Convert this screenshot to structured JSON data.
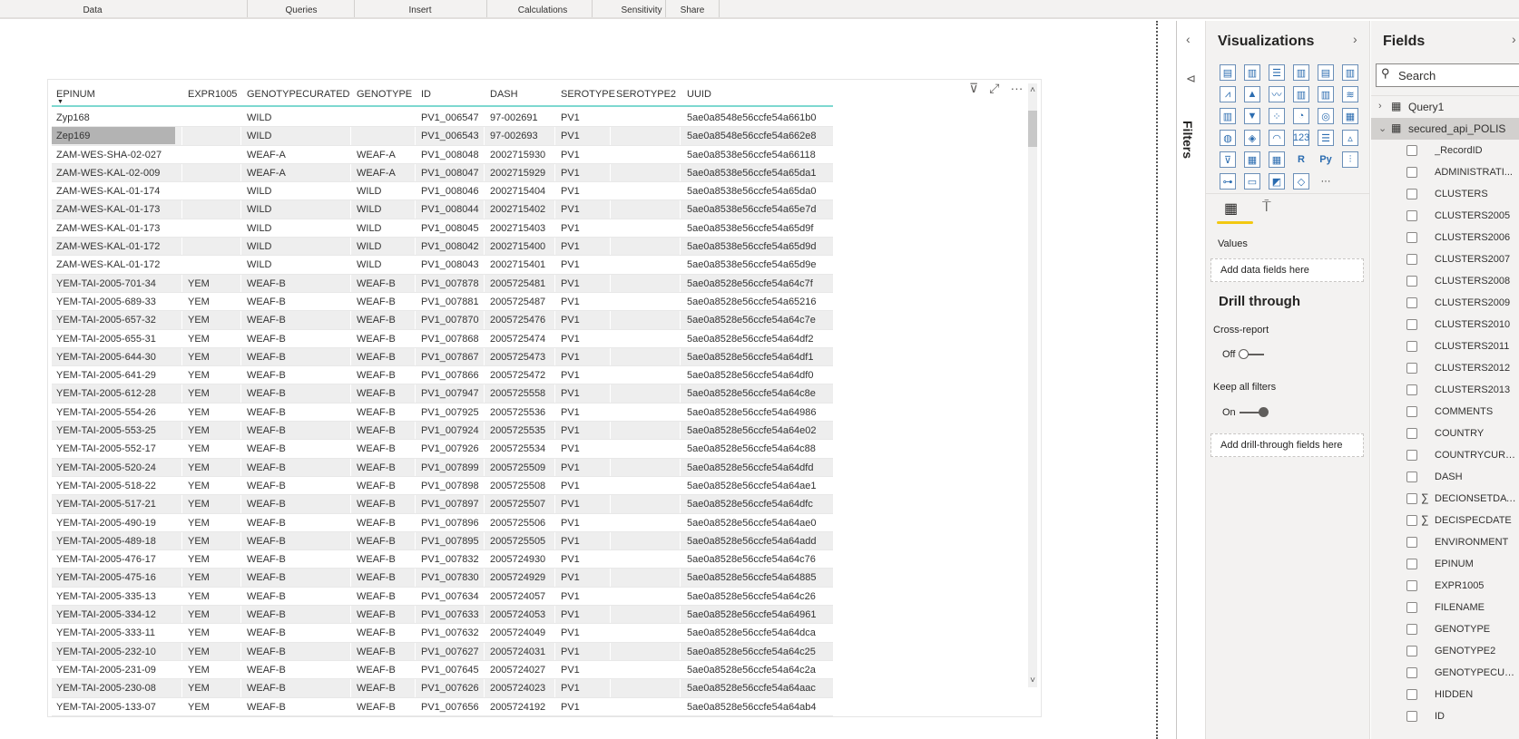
{
  "ribbon": {
    "groups": [
      "Data",
      "Queries",
      "Insert",
      "Calculations",
      "Sensitivity",
      "Share"
    ]
  },
  "visual_header": {
    "icons": [
      "filter-icon",
      "focus-mode-icon",
      "more-options-icon"
    ],
    "more": "···"
  },
  "table": {
    "columns": [
      "EPINUM",
      "EXPR1005",
      "GENOTYPECURATED",
      "GENOTYPE",
      "ID",
      "DASH",
      "SEROTYPE",
      "SEROTYPE2",
      "UUID"
    ],
    "sort_indicator": "▼",
    "selected_cell": {
      "row": 1,
      "column": "EPINUM"
    },
    "rows": [
      [
        "Zyp168",
        "",
        "WILD",
        "",
        "PV1_006547",
        "97-002691",
        "PV1",
        "",
        "5ae0a8548e56ccfe54a661b0"
      ],
      [
        "Zep169",
        "",
        "WILD",
        "",
        "PV1_006543",
        "97-002693",
        "PV1",
        "",
        "5ae0a8548e56ccfe54a662e8"
      ],
      [
        "ZAM-WES-SHA-02-027",
        "",
        "WEAF-A",
        "WEAF-A",
        "PV1_008048",
        "2002715930",
        "PV1",
        "",
        "5ae0a8538e56ccfe54a66118"
      ],
      [
        "ZAM-WES-KAL-02-009",
        "",
        "WEAF-A",
        "WEAF-A",
        "PV1_008047",
        "2002715929",
        "PV1",
        "",
        "5ae0a8538e56ccfe54a65da1"
      ],
      [
        "ZAM-WES-KAL-01-174",
        "",
        "WILD",
        "WILD",
        "PV1_008046",
        "2002715404",
        "PV1",
        "",
        "5ae0a8538e56ccfe54a65da0"
      ],
      [
        "ZAM-WES-KAL-01-173",
        "",
        "WILD",
        "WILD",
        "PV1_008044",
        "2002715402",
        "PV1",
        "",
        "5ae0a8538e56ccfe54a65e7d"
      ],
      [
        "ZAM-WES-KAL-01-173",
        "",
        "WILD",
        "WILD",
        "PV1_008045",
        "2002715403",
        "PV1",
        "",
        "5ae0a8538e56ccfe54a65d9f"
      ],
      [
        "ZAM-WES-KAL-01-172",
        "",
        "WILD",
        "WILD",
        "PV1_008042",
        "2002715400",
        "PV1",
        "",
        "5ae0a8538e56ccfe54a65d9d"
      ],
      [
        "ZAM-WES-KAL-01-172",
        "",
        "WILD",
        "WILD",
        "PV1_008043",
        "2002715401",
        "PV1",
        "",
        "5ae0a8538e56ccfe54a65d9e"
      ],
      [
        "YEM-TAI-2005-701-34",
        "YEM",
        "WEAF-B",
        "WEAF-B",
        "PV1_007878",
        "2005725481",
        "PV1",
        "",
        "5ae0a8528e56ccfe54a64c7f"
      ],
      [
        "YEM-TAI-2005-689-33",
        "YEM",
        "WEAF-B",
        "WEAF-B",
        "PV1_007881",
        "2005725487",
        "PV1",
        "",
        "5ae0a8528e56ccfe54a65216"
      ],
      [
        "YEM-TAI-2005-657-32",
        "YEM",
        "WEAF-B",
        "WEAF-B",
        "PV1_007870",
        "2005725476",
        "PV1",
        "",
        "5ae0a8528e56ccfe54a64c7e"
      ],
      [
        "YEM-TAI-2005-655-31",
        "YEM",
        "WEAF-B",
        "WEAF-B",
        "PV1_007868",
        "2005725474",
        "PV1",
        "",
        "5ae0a8528e56ccfe54a64df2"
      ],
      [
        "YEM-TAI-2005-644-30",
        "YEM",
        "WEAF-B",
        "WEAF-B",
        "PV1_007867",
        "2005725473",
        "PV1",
        "",
        "5ae0a8528e56ccfe54a64df1"
      ],
      [
        "YEM-TAI-2005-641-29",
        "YEM",
        "WEAF-B",
        "WEAF-B",
        "PV1_007866",
        "2005725472",
        "PV1",
        "",
        "5ae0a8528e56ccfe54a64df0"
      ],
      [
        "YEM-TAI-2005-612-28",
        "YEM",
        "WEAF-B",
        "WEAF-B",
        "PV1_007947",
        "2005725558",
        "PV1",
        "",
        "5ae0a8528e56ccfe54a64c8e"
      ],
      [
        "YEM-TAI-2005-554-26",
        "YEM",
        "WEAF-B",
        "WEAF-B",
        "PV1_007925",
        "2005725536",
        "PV1",
        "",
        "5ae0a8528e56ccfe54a64986"
      ],
      [
        "YEM-TAI-2005-553-25",
        "YEM",
        "WEAF-B",
        "WEAF-B",
        "PV1_007924",
        "2005725535",
        "PV1",
        "",
        "5ae0a8528e56ccfe54a64e02"
      ],
      [
        "YEM-TAI-2005-552-17",
        "YEM",
        "WEAF-B",
        "WEAF-B",
        "PV1_007926",
        "2005725534",
        "PV1",
        "",
        "5ae0a8528e56ccfe54a64c88"
      ],
      [
        "YEM-TAI-2005-520-24",
        "YEM",
        "WEAF-B",
        "WEAF-B",
        "PV1_007899",
        "2005725509",
        "PV1",
        "",
        "5ae0a8528e56ccfe54a64dfd"
      ],
      [
        "YEM-TAI-2005-518-22",
        "YEM",
        "WEAF-B",
        "WEAF-B",
        "PV1_007898",
        "2005725508",
        "PV1",
        "",
        "5ae0a8528e56ccfe54a64ae1"
      ],
      [
        "YEM-TAI-2005-517-21",
        "YEM",
        "WEAF-B",
        "WEAF-B",
        "PV1_007897",
        "2005725507",
        "PV1",
        "",
        "5ae0a8528e56ccfe54a64dfc"
      ],
      [
        "YEM-TAI-2005-490-19",
        "YEM",
        "WEAF-B",
        "WEAF-B",
        "PV1_007896",
        "2005725506",
        "PV1",
        "",
        "5ae0a8528e56ccfe54a64ae0"
      ],
      [
        "YEM-TAI-2005-489-18",
        "YEM",
        "WEAF-B",
        "WEAF-B",
        "PV1_007895",
        "2005725505",
        "PV1",
        "",
        "5ae0a8528e56ccfe54a64add"
      ],
      [
        "YEM-TAI-2005-476-17",
        "YEM",
        "WEAF-B",
        "WEAF-B",
        "PV1_007832",
        "2005724930",
        "PV1",
        "",
        "5ae0a8528e56ccfe54a64c76"
      ],
      [
        "YEM-TAI-2005-475-16",
        "YEM",
        "WEAF-B",
        "WEAF-B",
        "PV1_007830",
        "2005724929",
        "PV1",
        "",
        "5ae0a8528e56ccfe54a64885"
      ],
      [
        "YEM-TAI-2005-335-13",
        "YEM",
        "WEAF-B",
        "WEAF-B",
        "PV1_007634",
        "2005724057",
        "PV1",
        "",
        "5ae0a8528e56ccfe54a64c26"
      ],
      [
        "YEM-TAI-2005-334-12",
        "YEM",
        "WEAF-B",
        "WEAF-B",
        "PV1_007633",
        "2005724053",
        "PV1",
        "",
        "5ae0a8528e56ccfe54a64961"
      ],
      [
        "YEM-TAI-2005-333-11",
        "YEM",
        "WEAF-B",
        "WEAF-B",
        "PV1_007632",
        "2005724049",
        "PV1",
        "",
        "5ae0a8528e56ccfe54a64dca"
      ],
      [
        "YEM-TAI-2005-232-10",
        "YEM",
        "WEAF-B",
        "WEAF-B",
        "PV1_007627",
        "2005724031",
        "PV1",
        "",
        "5ae0a8528e56ccfe54a64c25"
      ],
      [
        "YEM-TAI-2005-231-09",
        "YEM",
        "WEAF-B",
        "WEAF-B",
        "PV1_007645",
        "2005724027",
        "PV1",
        "",
        "5ae0a8528e56ccfe54a64c2a"
      ],
      [
        "YEM-TAI-2005-230-08",
        "YEM",
        "WEAF-B",
        "WEAF-B",
        "PV1_007626",
        "2005724023",
        "PV1",
        "",
        "5ae0a8528e56ccfe54a64aac"
      ],
      [
        "YEM-TAI-2005-133-07",
        "YEM",
        "WEAF-B",
        "WEAF-B",
        "PV1_007656",
        "2005724192",
        "PV1",
        "",
        "5ae0a8528e56ccfe54a64ab4"
      ]
    ]
  },
  "filters": {
    "label": "Filters",
    "collapse": "‹",
    "icon": "filter-icon"
  },
  "visualizations": {
    "title": "Visualizations",
    "expand": "›",
    "icons": [
      [
        "stacked-bar",
        "stacked-column",
        "clustered-bar",
        "clustered-column",
        "100-stacked-bar",
        "100-stacked-column"
      ],
      [
        "line",
        "area",
        "stacked-area",
        "line-stacked-column",
        "line-clustered-column",
        "ribbon"
      ],
      [
        "waterfall",
        "funnel",
        "scatter",
        "pie",
        "donut",
        "treemap"
      ],
      [
        "map",
        "filled-map",
        "gauge",
        "card",
        "multi-row-card",
        "kpi"
      ],
      [
        "slicer",
        "table",
        "matrix",
        "r-script",
        "python",
        "key-influencers"
      ],
      [
        "decomposition-tree",
        "qna",
        "arcgis",
        "power-apps",
        "more"
      ]
    ],
    "icon_glyphs": [
      [
        "▤",
        "▥",
        "☰",
        "▥",
        "▤",
        "▥"
      ],
      [
        "⩘",
        "▲",
        "〰",
        "▥",
        "▥",
        "≋"
      ],
      [
        "▥",
        "▼",
        "⁘",
        "◔",
        "◎",
        "▦"
      ],
      [
        "◍",
        "◈",
        "◠",
        "123",
        "☰",
        "▵"
      ],
      [
        "⊽",
        "▦",
        "▦",
        "R",
        "Py",
        "⫶"
      ],
      [
        "⊶",
        "▭",
        "◩",
        "◇",
        "···"
      ]
    ],
    "tabs": {
      "fields": "fields-tab-icon",
      "format": "format-paint-roller-icon"
    },
    "values_label": "Values",
    "values_placeholder": "Add data fields here",
    "drill_title": "Drill through",
    "cross_report_label": "Cross-report",
    "cross_report_state": "Off",
    "cross_report_on": false,
    "keep_filters_label": "Keep all filters",
    "keep_filters_state": "On",
    "keep_filters_on": true,
    "drill_placeholder": "Add drill-through fields here"
  },
  "fields": {
    "title": "Fields",
    "close": "›",
    "search_placeholder": "Search",
    "tables": [
      {
        "name": "Query1",
        "expanded": false
      },
      {
        "name": "secured_api_POLIS",
        "expanded": true
      }
    ],
    "items": [
      {
        "name": "_RecordID",
        "sigma": false
      },
      {
        "name": "ADMINISTRATI...",
        "sigma": false
      },
      {
        "name": "CLUSTERS",
        "sigma": false
      },
      {
        "name": "CLUSTERS2005",
        "sigma": false
      },
      {
        "name": "CLUSTERS2006",
        "sigma": false
      },
      {
        "name": "CLUSTERS2007",
        "sigma": false
      },
      {
        "name": "CLUSTERS2008",
        "sigma": false
      },
      {
        "name": "CLUSTERS2009",
        "sigma": false
      },
      {
        "name": "CLUSTERS2010",
        "sigma": false
      },
      {
        "name": "CLUSTERS2011",
        "sigma": false
      },
      {
        "name": "CLUSTERS2012",
        "sigma": false
      },
      {
        "name": "CLUSTERS2013",
        "sigma": false
      },
      {
        "name": "COMMENTS",
        "sigma": false
      },
      {
        "name": "COUNTRY",
        "sigma": false
      },
      {
        "name": "COUNTRYCURA...",
        "sigma": false
      },
      {
        "name": "DASH",
        "sigma": false
      },
      {
        "name": "DECIONSETDATE",
        "sigma": true
      },
      {
        "name": "DECISPECDATE",
        "sigma": true
      },
      {
        "name": "ENVIRONMENT",
        "sigma": false
      },
      {
        "name": "EPINUM",
        "sigma": false
      },
      {
        "name": "EXPR1005",
        "sigma": false
      },
      {
        "name": "FILENAME",
        "sigma": false
      },
      {
        "name": "GENOTYPE",
        "sigma": false
      },
      {
        "name": "GENOTYPE2",
        "sigma": false
      },
      {
        "name": "GENOTYPECUR...",
        "sigma": false
      },
      {
        "name": "HIDDEN",
        "sigma": false
      },
      {
        "name": "ID",
        "sigma": false
      }
    ],
    "sigma_glyph": "∑"
  },
  "colors": {
    "accent_header_line": "#7ed8d0",
    "selection": "#f2c811",
    "pane_bg": "#f3f2f1",
    "alt_row": "#eeeeee",
    "selected_cell": "#b3b3b3"
  }
}
